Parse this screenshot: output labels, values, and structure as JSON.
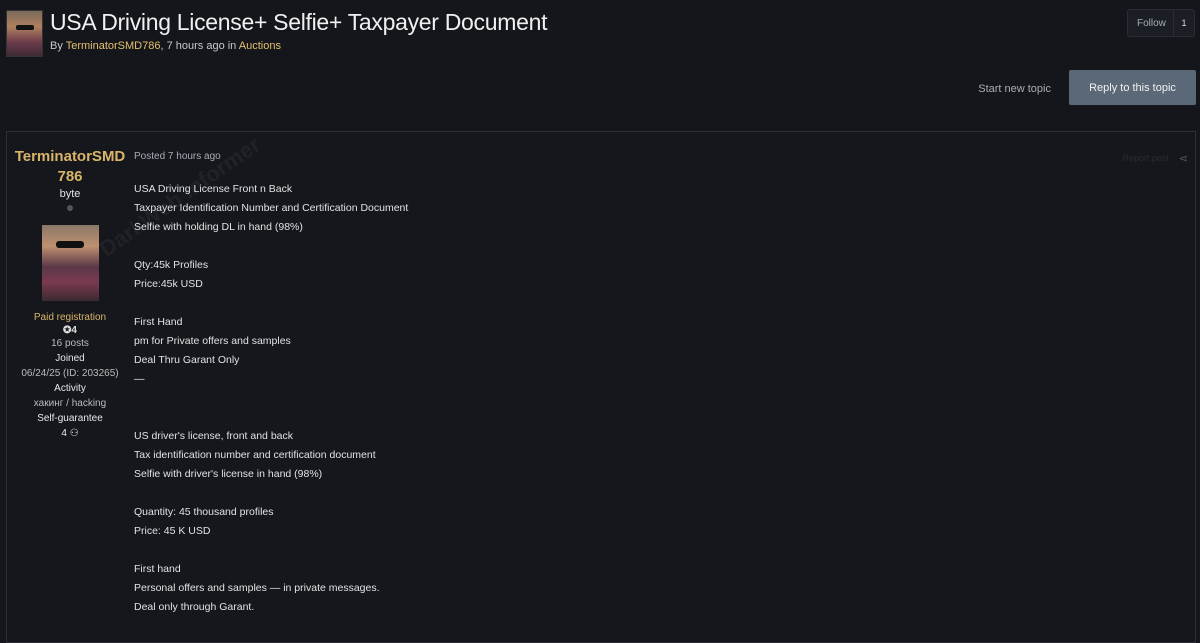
{
  "header": {
    "title": "USA Driving License+ Selfie+ Taxpayer Document",
    "byline_prefix": "By ",
    "author": "TerminatorSMD786",
    "byline_suffix": ", 7 hours ago in ",
    "forum": "Auctions",
    "follow_label": "Follow",
    "follow_count": "1"
  },
  "actions": {
    "start_topic": "Start new topic",
    "reply": "Reply to this topic"
  },
  "author": {
    "name": "TerminatorSMD786",
    "rank": "byte",
    "group": "Paid registration",
    "reputation": "4",
    "posts": "16 posts",
    "joined_label": "Joined",
    "joined_value": "06/24/25 (ID: 203265)",
    "activity_label": "Activity",
    "activity_value": "хакинг / hacking",
    "self_guarantee_label": "Self-guarantee",
    "self_guarantee_value": "4"
  },
  "watermark": "DarkWeb Informer",
  "post": {
    "posted": "Posted 7 hours ago",
    "report": "Report post",
    "lines": [
      "USA Driving License Front n Back",
      "Taxpayer Identification Number and Certification Document",
      "Selfie with holding DL in hand (98%)",
      "",
      "Qty:45k Profiles",
      "Price:45k USD",
      "",
      "First Hand",
      "pm for Private offers and samples",
      "Deal Thru Garant Only",
      "—",
      "",
      "",
      "US driver's license, front and back",
      "Tax identification number and certification document",
      "Selfie with driver's license in hand (98%)",
      "",
      "Quantity: 45 thousand profiles",
      "Price: 45 K USD",
      "",
      "First hand",
      "Personal offers and samples — in private messages.",
      "Deal only through Garant."
    ]
  },
  "colors": {
    "background": "#14161b",
    "accent_gold": "#d9b56a",
    "reply_button": "#5b6877"
  }
}
